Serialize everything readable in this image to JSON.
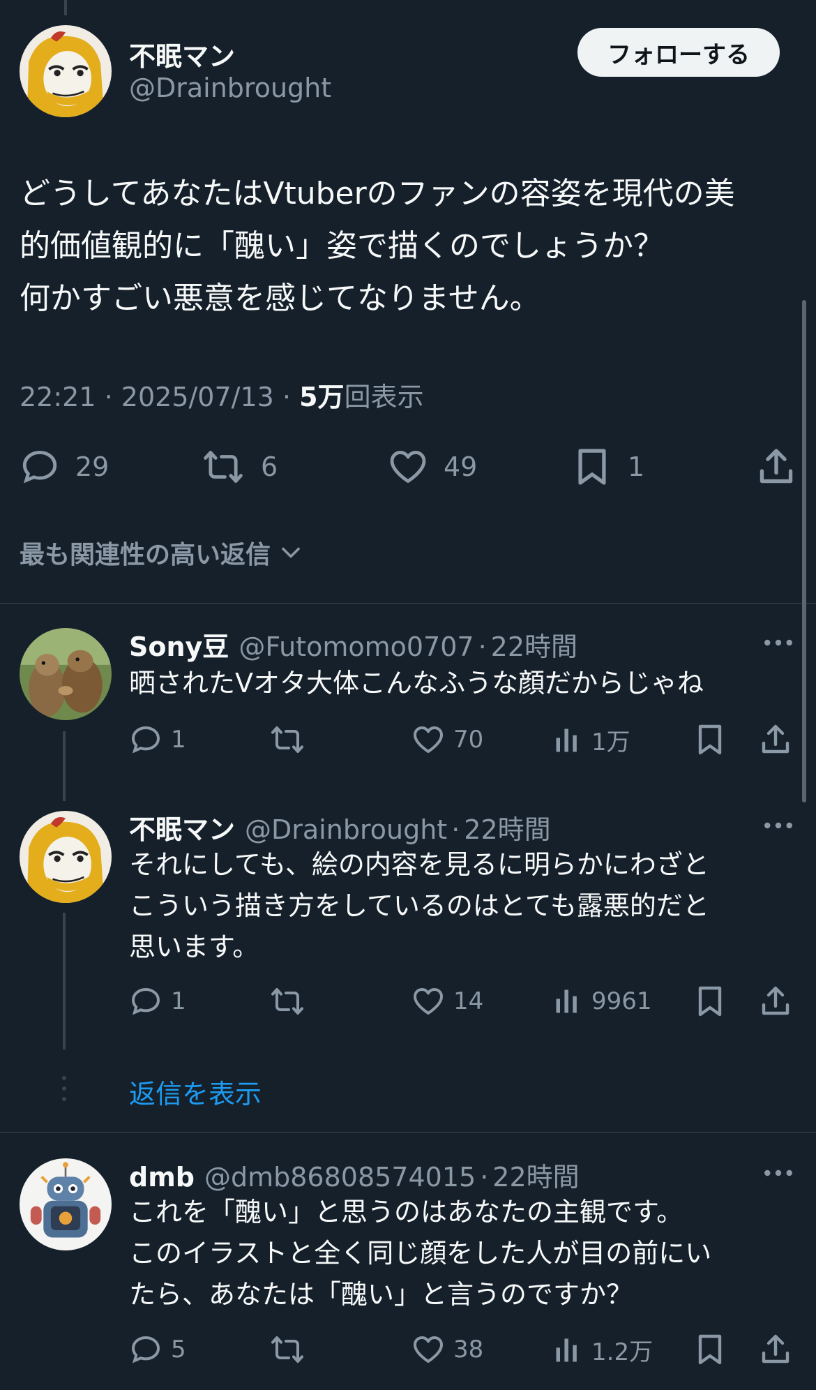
{
  "main_tweet": {
    "author_name": "不眠マン",
    "author_handle": "@Drainbrought",
    "follow_label": "フォローする",
    "text": "どうしてあなたはVtuberのファンの容姿を現代の美\n的価値観的に「醜い」姿で描くのでしょうか？\n何かすごい悪意を感じてなりません。",
    "time": "22:21",
    "date": "2025/07/13",
    "views_number": "5万",
    "views_suffix": "回表示",
    "replies": "29",
    "retweets": "6",
    "likes": "49",
    "bookmarks": "1",
    "sort_label": "最も関連性の高い返信"
  },
  "replies": [
    {
      "name": "Sony豆",
      "handle": "@Futomomo0707",
      "time": "22時間",
      "text": "晒されたVオタ大体こんなふうな顔だからじゃね",
      "replies": "1",
      "retweets": "",
      "likes": "70",
      "views": "1万"
    },
    {
      "name": "不眠マン",
      "handle": "@Drainbrought",
      "time": "22時間",
      "text": "それにしても、絵の内容を見るに明らかにわざと\nこういう描き方をしているのはとても露悪的だと\n思います。",
      "replies": "1",
      "retweets": "",
      "likes": "14",
      "views": "9961"
    },
    {
      "name": "dmb",
      "handle": "@dmb86808574015",
      "time": "22時間",
      "text": "これを「醜い」と思うのはあなたの主観です。\nこのイラストと全く同じ顔をした人が目の前にい\nたら、あなたは「醜い」と言うのですか？",
      "replies": "5",
      "retweets": "",
      "likes": "38",
      "views": "1.2万"
    }
  ],
  "show_replies_label": "返信を表示",
  "meta_separator": "·",
  "icons": {
    "reply": "speech-bubble-icon",
    "retweet": "retweet-arrows-icon",
    "like": "heart-icon",
    "bookmark": "bookmark-icon",
    "share": "share-upload-icon",
    "views": "bar-chart-icon",
    "more": "ellipsis-icon",
    "sort": "chevron-down-icon"
  },
  "colors": {
    "background": "#15202b",
    "text": "#f7f9f9",
    "muted": "#8b98a5",
    "link": "#1d9bf0",
    "divider": "#38444d"
  }
}
